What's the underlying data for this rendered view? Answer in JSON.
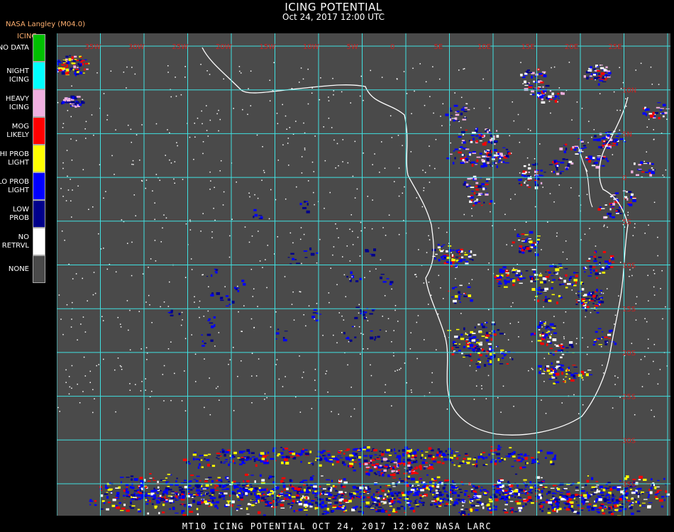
{
  "header": {
    "source": "NASA Langley (M04.0)",
    "product": "ICING",
    "title": "ICING POTENTIAL",
    "datetime": "Oct 24, 2017 12:00 UTC"
  },
  "legend": [
    {
      "label": "NO DATA",
      "color": "#00c000"
    },
    {
      "label": "NIGHT\nICING",
      "color": "#00ffff"
    },
    {
      "label": "HEAVY\nICING",
      "color": "#f0b0e0"
    },
    {
      "label": "MOG\nLIKELY",
      "color": "#ff0000"
    },
    {
      "label": "HI PROB\nLIGHT",
      "color": "#ffff00"
    },
    {
      "label": "LO PROB\nLIGHT",
      "color": "#0000ff"
    },
    {
      "label": "LOW\nPROB",
      "color": "#00008b"
    },
    {
      "label": "NO\nRETRVL",
      "color": "#ffffff"
    },
    {
      "label": "NONE",
      "color": "#4a4a4a"
    }
  ],
  "map": {
    "background_color": "#4a4a4a",
    "grid_color": "#40e0e0",
    "coastline_color": "#ffffff",
    "grid_label_color": "#cc2020",
    "lon_labels": [
      "35W",
      "30W",
      "25W",
      "20W",
      "15W",
      "10W",
      "5W",
      "0",
      "5E",
      "10E",
      "15E",
      "20E",
      "25E",
      "30E"
    ],
    "lat_labels": [
      "10N",
      "5N",
      "0",
      "5S",
      "10S",
      "15S",
      "20S",
      "25S",
      "30S",
      "35S",
      "40S"
    ]
  },
  "footer": {
    "text": "MT10   ICING POTENTIAL    OCT 24, 2017 12:00Z   NASA LARC"
  }
}
